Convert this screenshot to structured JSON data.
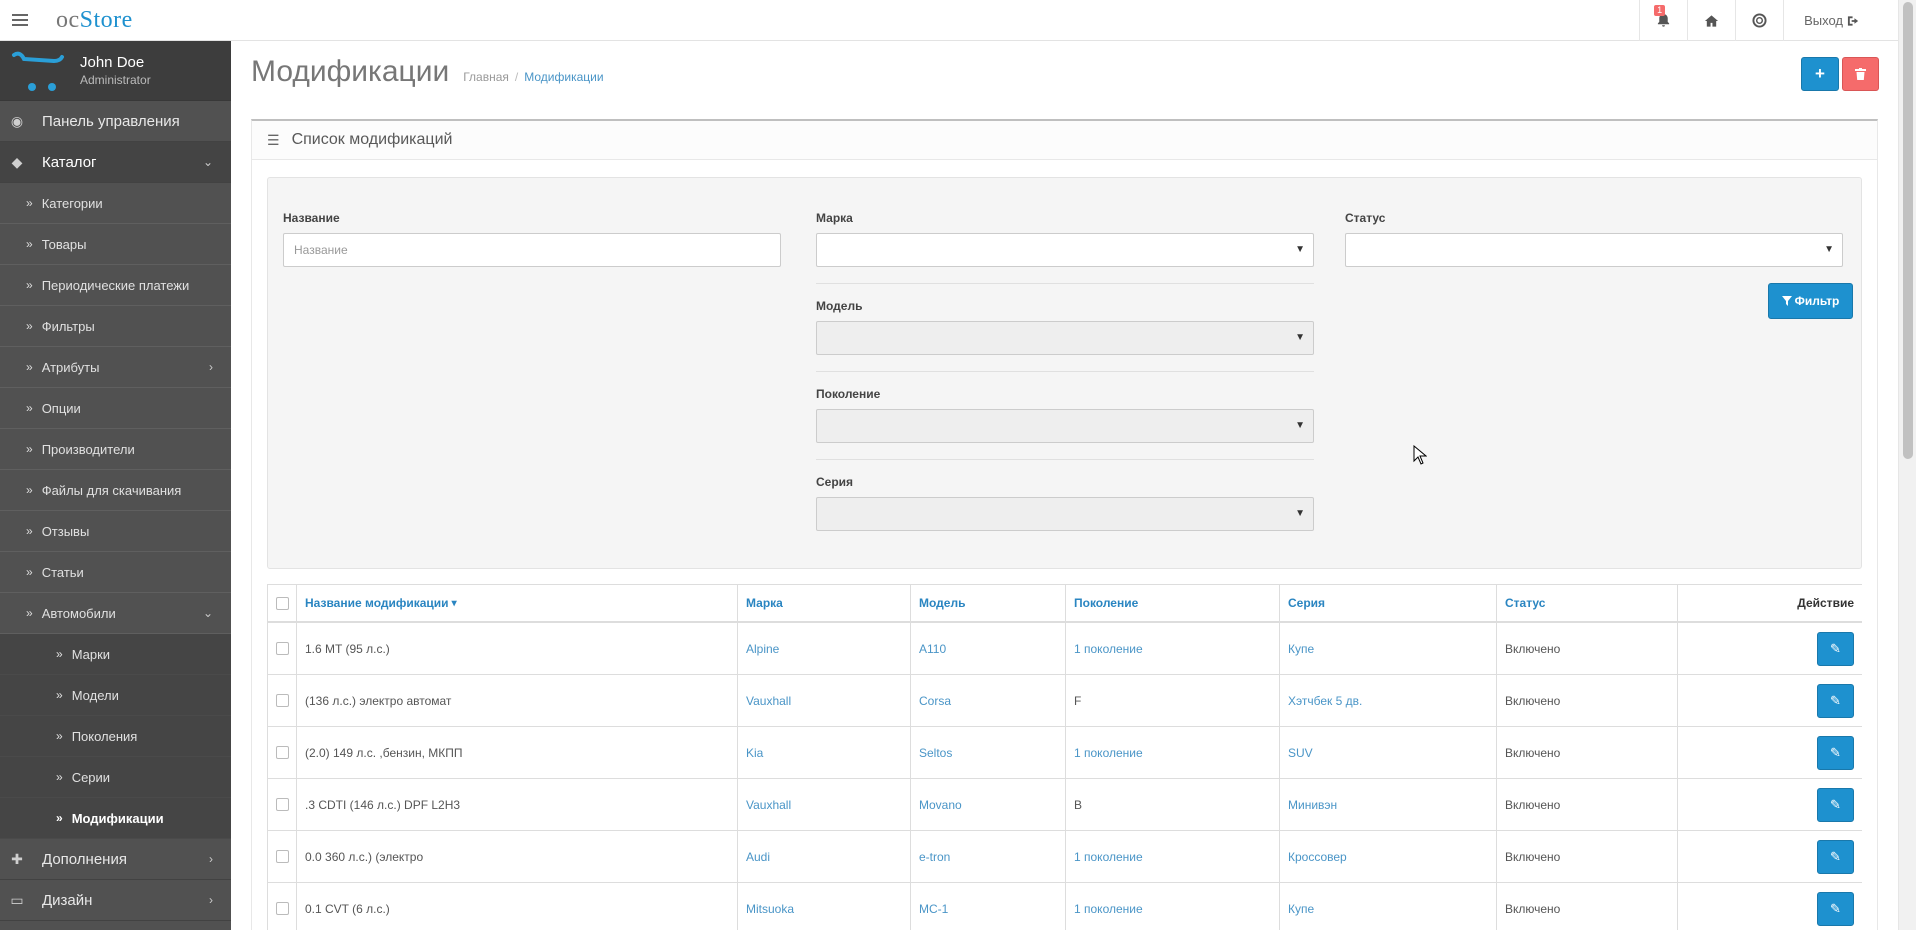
{
  "header": {
    "logo_oc": "oc",
    "logo_store": "Store",
    "notification_count": "1",
    "logout_label": "Выход"
  },
  "profile": {
    "name": "John Doe",
    "role": "Administrator"
  },
  "sidebar": {
    "dashboard": "Панель управления",
    "catalog": "Каталог",
    "catalog_items": [
      "Категории",
      "Товары",
      "Периодические платежи",
      "Фильтры",
      "Атрибуты",
      "Опции",
      "Производители",
      "Файлы для скачивания",
      "Отзывы",
      "Статьи",
      "Автомобили"
    ],
    "cars_items": [
      "Марки",
      "Модели",
      "Поколения",
      "Серии",
      "Модификации"
    ],
    "extensions": "Дополнения",
    "design": "Дизайн"
  },
  "page": {
    "title": "Модификации",
    "breadcrumb_home": "Главная",
    "breadcrumb_current": "Модификации",
    "panel_title": "Список модификаций"
  },
  "filter": {
    "name_label": "Название",
    "name_placeholder": "Название",
    "brand_label": "Марка",
    "status_label": "Статус",
    "model_label": "Модель",
    "generation_label": "Поколение",
    "series_label": "Серия",
    "filter_button": "Фильтр"
  },
  "table": {
    "headers": [
      "Название модификации",
      "Марка",
      "Модель",
      "Поколение",
      "Серия",
      "Статус",
      "Действие"
    ],
    "rows": [
      [
        "1.6 MT (95 л.с.)",
        "Alpine",
        "A110",
        "1 поколение",
        "Купе",
        "Включено"
      ],
      [
        "(136 л.с.) электро автомат",
        "Vauxhall",
        "Corsa",
        "F",
        "Хэтчбек 5 дв.",
        "Включено"
      ],
      [
        "(2.0) 149 л.с. ,бензин, МКПП",
        "Kia",
        "Seltos",
        "1 поколение",
        "SUV",
        "Включено"
      ],
      [
        ".3 CDTI (146 л.с.) DPF L2H3",
        "Vauxhall",
        "Movano",
        "B",
        "Минивэн",
        "Включено"
      ],
      [
        "0.0 360 л.с.) (электро",
        "Audi",
        "e-tron",
        "1 поколение",
        "Кроссовер",
        "Включено"
      ],
      [
        "0.1 CVT (6 л.с.)",
        "Mitsuoka",
        "MC-1",
        "1 поколение",
        "Купе",
        "Включено"
      ]
    ]
  },
  "colors": {
    "primary": "#1e91cf",
    "danger": "#f56b6b",
    "sidebar": "#515151"
  }
}
